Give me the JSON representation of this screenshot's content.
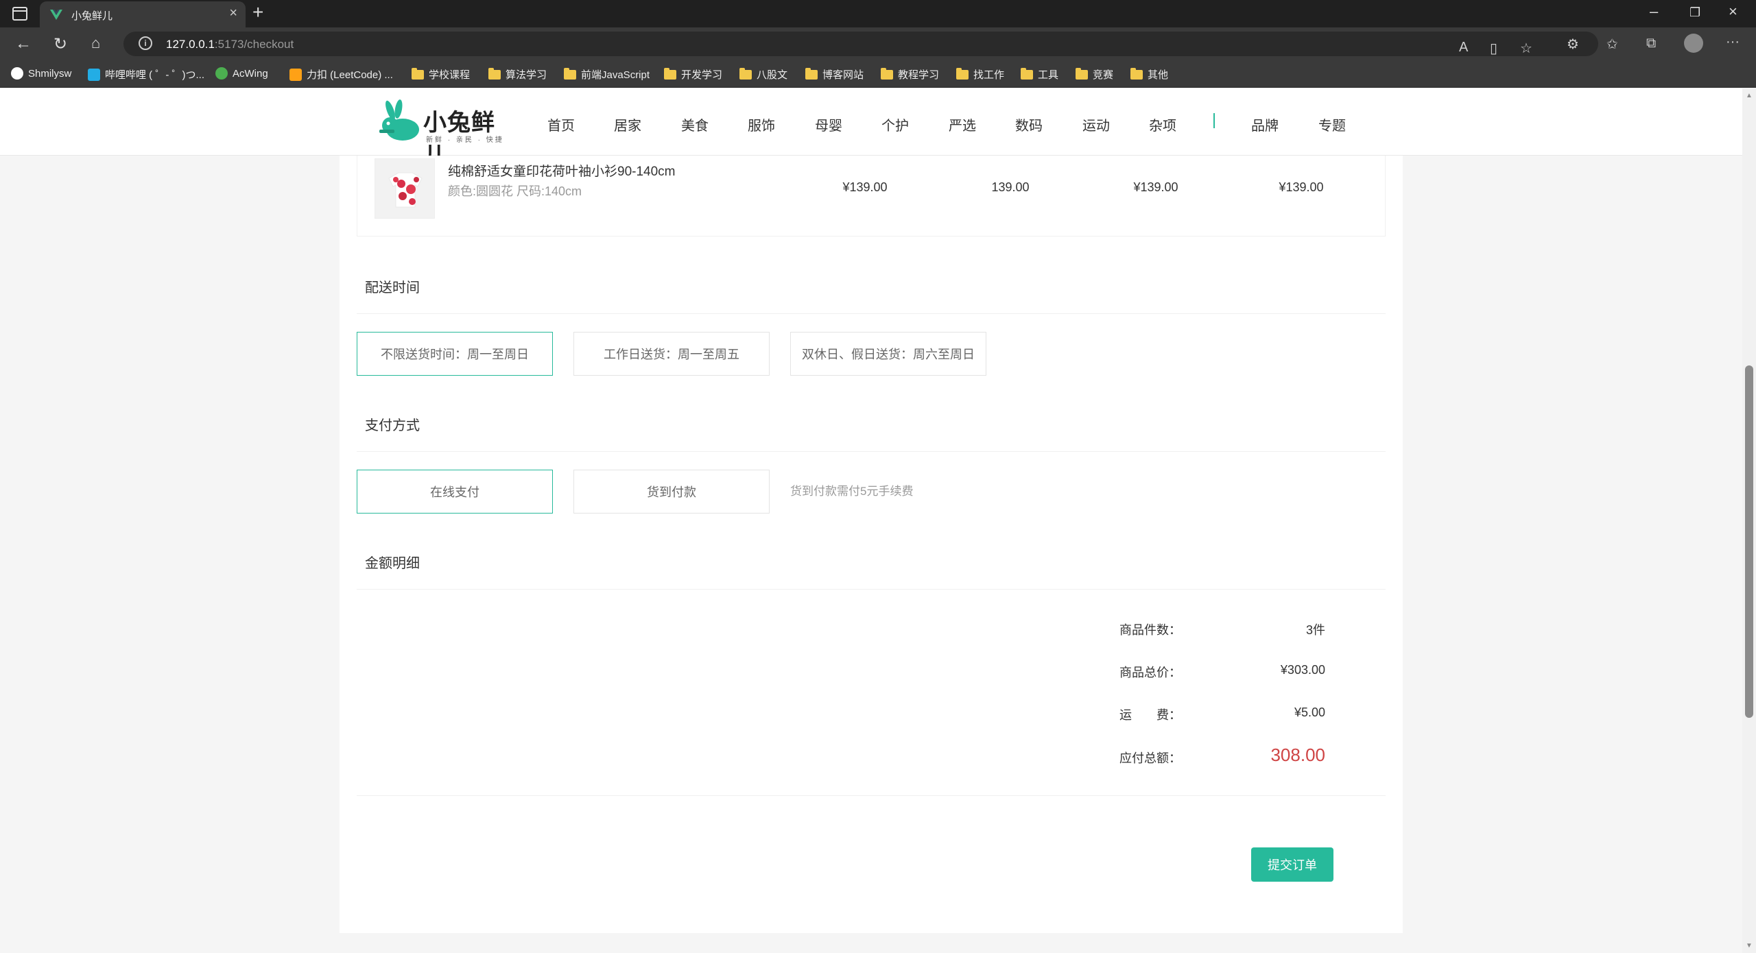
{
  "browser": {
    "tab_title": "小兔鲜儿",
    "url_host": "127.0.0.1",
    "url_rest": ":5173/checkout",
    "bookmarks": [
      "Shmilysw",
      "哔哩哔哩 ( ゜- ゜)つ...",
      "AcWing",
      "力扣 (LeetCode) ...",
      "学校课程",
      "算法学习",
      "前端JavaScript",
      "开发学习",
      "八股文",
      "博客网站",
      "教程学习",
      "找工作",
      "工具",
      "竞赛",
      "其他"
    ]
  },
  "header": {
    "logo_text": "小兔鲜儿",
    "logo_sub": "新鲜 · 亲民 · 快捷",
    "nav": [
      "首页",
      "居家",
      "美食",
      "服饰",
      "母婴",
      "个护",
      "严选",
      "数码",
      "运动",
      "杂项",
      "品牌",
      "专题"
    ]
  },
  "goods": {
    "name": "纯棉舒适女童印花荷叶袖小衫90-140cm",
    "attrs": "颜色:圆圆花 尺码:140cm",
    "price": "¥139.00",
    "count": "139.00",
    "subtotal": "¥139.00",
    "payable": "¥139.00"
  },
  "delivery": {
    "title": "配送时间",
    "options": [
      "不限送货时间：周一至周日",
      "工作日送货：周一至周五",
      "双休日、假日送货：周六至周日"
    ]
  },
  "payment": {
    "title": "支付方式",
    "options": [
      "在线支付",
      "货到付款"
    ],
    "tip": "货到付款需付5元手续费"
  },
  "summary": {
    "title": "金额明细",
    "count_label": "商品件数：",
    "count_value": "3件",
    "total_label": "商品总价：",
    "total_value": "¥303.00",
    "freight_label": "运　　费：",
    "freight_value": "¥5.00",
    "pay_label": "应付总额：",
    "pay_value": "308.00"
  },
  "submit_label": "提交订单",
  "colors": {
    "brand": "#27ba9b",
    "price": "#cf4444"
  }
}
